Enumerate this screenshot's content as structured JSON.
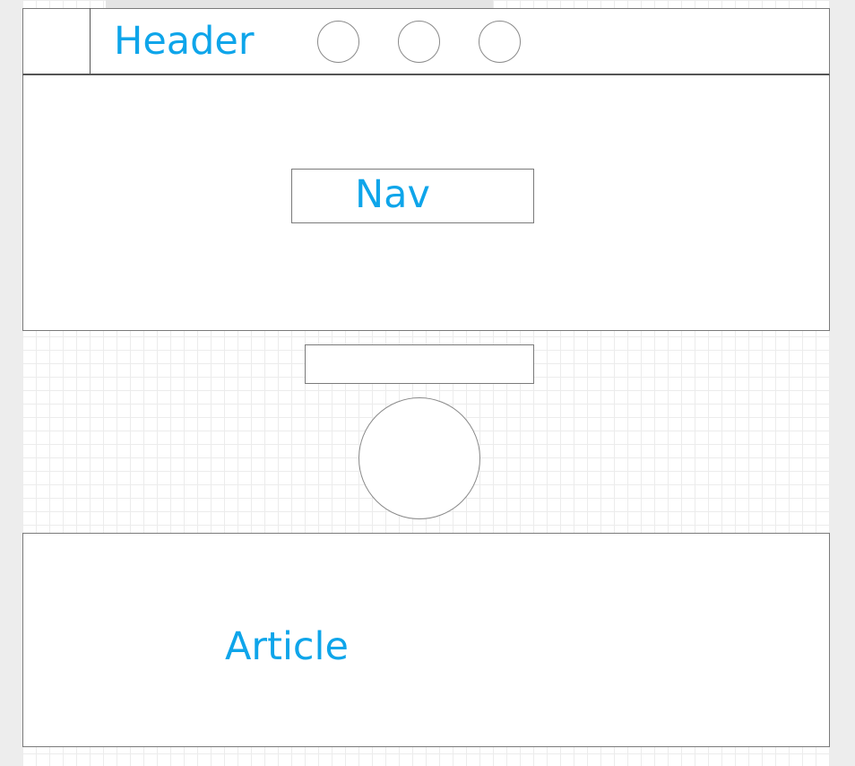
{
  "header": {
    "title": "Header",
    "circle_count": 3
  },
  "nav": {
    "label": "Nav"
  },
  "article": {
    "label": "Article"
  },
  "colors": {
    "label_text": "#0ea5ea",
    "border": "#7a7a7a",
    "grid_line": "#ececec",
    "page_background": "#ededed"
  }
}
